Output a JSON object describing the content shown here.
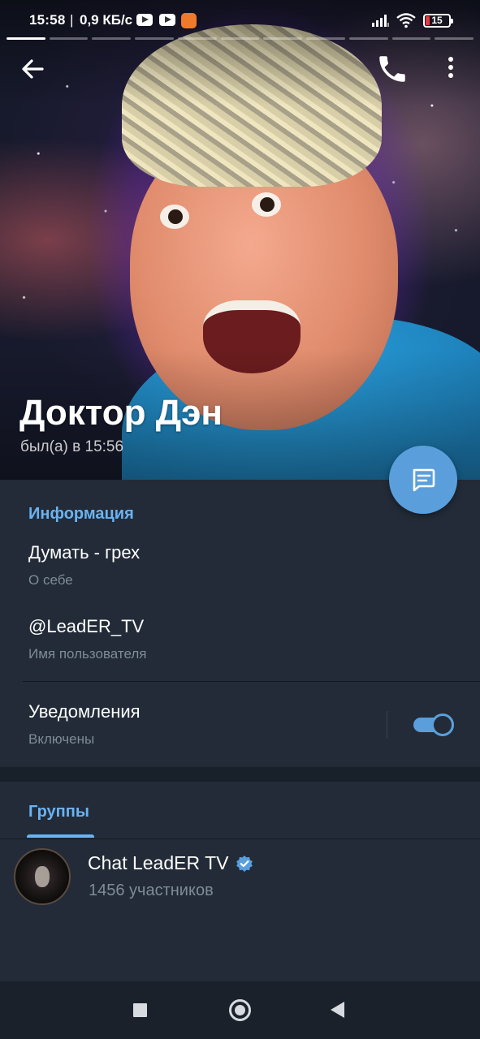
{
  "status_bar": {
    "time": "15:58",
    "separator": "|",
    "network_speed": "0,9 КБ/с",
    "battery_level": "15",
    "icons": [
      "youtube-icon",
      "youtube-icon",
      "app-notification-icon",
      "signal-icon",
      "wifi-icon",
      "battery-icon"
    ]
  },
  "toolbar": {
    "back_icon": "arrow-left-icon",
    "call_icon": "phone-icon",
    "more_icon": "more-vertical-icon"
  },
  "profile": {
    "name": "Доктор Дэн",
    "last_seen": "был(а) в 15:56"
  },
  "fab": {
    "icon": "message-icon"
  },
  "info": {
    "section_title": "Информация",
    "bio_value": "Думать - грех",
    "bio_caption": "О себе",
    "username_value": "@LeadER_TV",
    "username_caption": "Имя пользователя",
    "notifications_label": "Уведомления",
    "notifications_status": "Включены",
    "notifications_enabled": true
  },
  "groups": {
    "tab_label": "Группы",
    "items": [
      {
        "name": "Chat LeadER TV",
        "members": "1456 участников",
        "verified": true
      }
    ]
  },
  "nav_bar": {
    "icons": [
      "recents-square-icon",
      "home-circle-icon",
      "back-triangle-icon"
    ]
  },
  "colors": {
    "accent": "#6ab3f3",
    "fab": "#5a9fdc",
    "panel_bg": "#222b37",
    "caption": "#7f8b98"
  }
}
